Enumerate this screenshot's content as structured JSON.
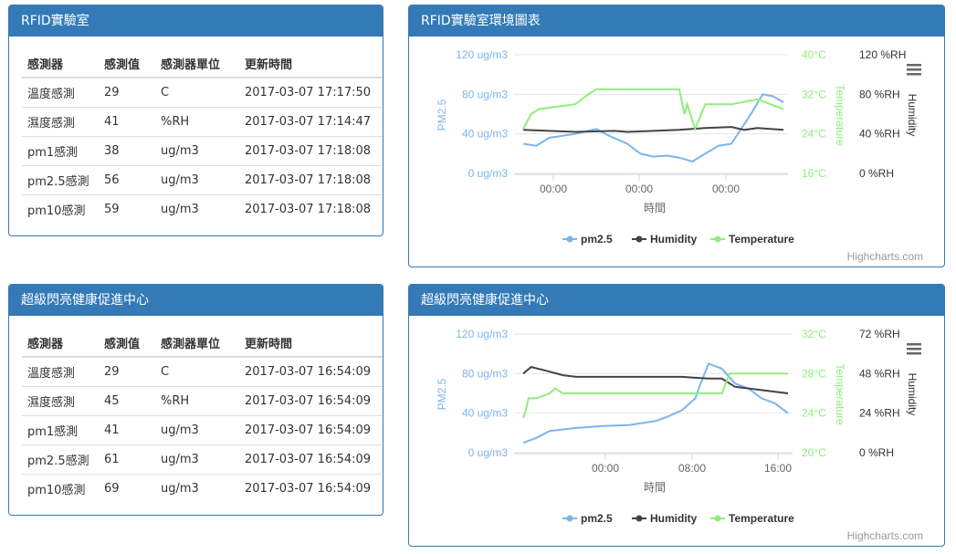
{
  "panel1": {
    "title": "RFID實驗室",
    "headers": [
      "感測器",
      "感測值",
      "感測器單位",
      "更新時間"
    ],
    "rows": [
      [
        "溫度感測",
        "29",
        "C",
        "2017-03-07 17:17:50"
      ],
      [
        "濕度感測",
        "41",
        "%RH",
        "2017-03-07 17:14:47"
      ],
      [
        "pm1感測",
        "38",
        "ug/m3",
        "2017-03-07 17:18:08"
      ],
      [
        "pm2.5感測",
        "56",
        "ug/m3",
        "2017-03-07 17:18:08"
      ],
      [
        "pm10感測",
        "59",
        "ug/m3",
        "2017-03-07 17:18:08"
      ]
    ]
  },
  "panel2": {
    "title": "超級閃亮健康促進中心",
    "headers": [
      "感測器",
      "感測值",
      "感測器單位",
      "更新時間"
    ],
    "rows": [
      [
        "溫度感測",
        "29",
        "C",
        "2017-03-07 16:54:09"
      ],
      [
        "濕度感測",
        "45",
        "%RH",
        "2017-03-07 16:54:09"
      ],
      [
        "pm1感測",
        "41",
        "ug/m3",
        "2017-03-07 16:54:09"
      ],
      [
        "pm2.5感測",
        "61",
        "ug/m3",
        "2017-03-07 16:54:09"
      ],
      [
        "pm10感測",
        "69",
        "ug/m3",
        "2017-03-07 16:54:09"
      ]
    ]
  },
  "chart1_panel_title": "RFID實驗室環境圖表",
  "chart2_panel_title": "超級閃亮健康促進中心",
  "chart_data": [
    {
      "type": "line",
      "credit": "Highcharts.com",
      "xlabel": "時間",
      "x_ticks": [
        "00:00",
        "00:00",
        "00:00"
      ],
      "left_axis": {
        "label": "PM2.5",
        "ticks": [
          "0 ug/m3",
          "40 ug/m3",
          "80 ug/m3",
          "120 ug/m3"
        ],
        "ylim": [
          0,
          120
        ]
      },
      "mid_axis": {
        "label": "Temperature",
        "ticks": [
          "16°C",
          "24°C",
          "32°C",
          "40°C"
        ],
        "ylim": [
          16,
          40
        ]
      },
      "right_axis": {
        "label": "Humidity",
        "ticks": [
          "0 %RH",
          "40 %RH",
          "80 %RH",
          "120 %RH"
        ],
        "ylim": [
          0,
          120
        ]
      },
      "legend": [
        "pm2.5",
        "Humidity",
        "Temperature"
      ],
      "colors": {
        "pm25": "#7cb5ec",
        "humidity": "#434348",
        "temperature": "#90ed7d"
      },
      "series": [
        {
          "name": "pm2.5",
          "x": [
            0,
            0.05,
            0.1,
            0.2,
            0.28,
            0.33,
            0.4,
            0.45,
            0.5,
            0.55,
            0.6,
            0.65,
            0.7,
            0.75,
            0.8,
            0.85,
            0.88,
            0.92,
            0.96,
            1.0
          ],
          "y": [
            30,
            28,
            36,
            40,
            45,
            38,
            30,
            20,
            17,
            18,
            16,
            12,
            20,
            28,
            30,
            50,
            62,
            80,
            78,
            72
          ]
        },
        {
          "name": "Humidity",
          "x": [
            0,
            0.1,
            0.2,
            0.35,
            0.4,
            0.5,
            0.6,
            0.7,
            0.8,
            0.85,
            0.9,
            1.0
          ],
          "y": [
            44,
            43,
            42,
            43,
            42,
            43,
            44,
            46,
            47,
            44,
            46,
            44
          ]
        },
        {
          "name": "Temperature",
          "x": [
            0,
            0.03,
            0.06,
            0.2,
            0.25,
            0.28,
            0.6,
            0.62,
            0.63,
            0.66,
            0.7,
            0.8,
            0.9,
            0.95,
            1.0
          ],
          "y": [
            25,
            28,
            29,
            30,
            32,
            33,
            33,
            28,
            30,
            25,
            30,
            30,
            31,
            30,
            29
          ]
        }
      ]
    },
    {
      "type": "line",
      "credit": "Highcharts.com",
      "xlabel": "時間",
      "x_ticks": [
        "00:00",
        "08:00",
        "16:00"
      ],
      "left_axis": {
        "label": "PM2.5",
        "ticks": [
          "0 ug/m3",
          "40 ug/m3",
          "80 ug/m3",
          "120 ug/m3"
        ],
        "ylim": [
          0,
          120
        ]
      },
      "mid_axis": {
        "label": "Temperature",
        "ticks": [
          "20°C",
          "24°C",
          "28°C",
          "32°C"
        ],
        "ylim": [
          20,
          32
        ]
      },
      "right_axis": {
        "label": "Humidity",
        "ticks": [
          "0 %RH",
          "24 %RH",
          "48 %RH",
          "72 %RH"
        ],
        "ylim": [
          0,
          72
        ]
      },
      "legend": [
        "pm2.5",
        "Humidity",
        "Temperature"
      ],
      "colors": {
        "pm25": "#7cb5ec",
        "humidity": "#434348",
        "temperature": "#90ed7d"
      },
      "series": [
        {
          "name": "pm2.5",
          "x": [
            0,
            0.05,
            0.1,
            0.2,
            0.3,
            0.4,
            0.5,
            0.55,
            0.6,
            0.65,
            0.67,
            0.7,
            0.75,
            0.8,
            0.85,
            0.9,
            0.95,
            1.0
          ],
          "y": [
            10,
            15,
            22,
            25,
            27,
            28,
            32,
            37,
            43,
            55,
            70,
            90,
            85,
            70,
            65,
            55,
            50,
            40
          ]
        },
        {
          "name": "Humidity",
          "x": [
            0,
            0.03,
            0.08,
            0.15,
            0.2,
            0.3,
            0.5,
            0.6,
            0.7,
            0.75,
            0.8,
            0.9,
            1.0
          ],
          "y": [
            48,
            52,
            50,
            47,
            46,
            46,
            46,
            46,
            45,
            45,
            40,
            38,
            36
          ]
        },
        {
          "name": "Temperature",
          "x": [
            0,
            0.01,
            0.02,
            0.05,
            0.1,
            0.12,
            0.15,
            0.3,
            0.5,
            0.6,
            0.72,
            0.75,
            0.78,
            0.8,
            1.0
          ],
          "y": [
            23.5,
            24.3,
            25.5,
            25.5,
            26,
            26.5,
            26,
            26,
            26,
            26,
            26,
            26,
            28,
            28,
            28
          ]
        }
      ]
    }
  ]
}
